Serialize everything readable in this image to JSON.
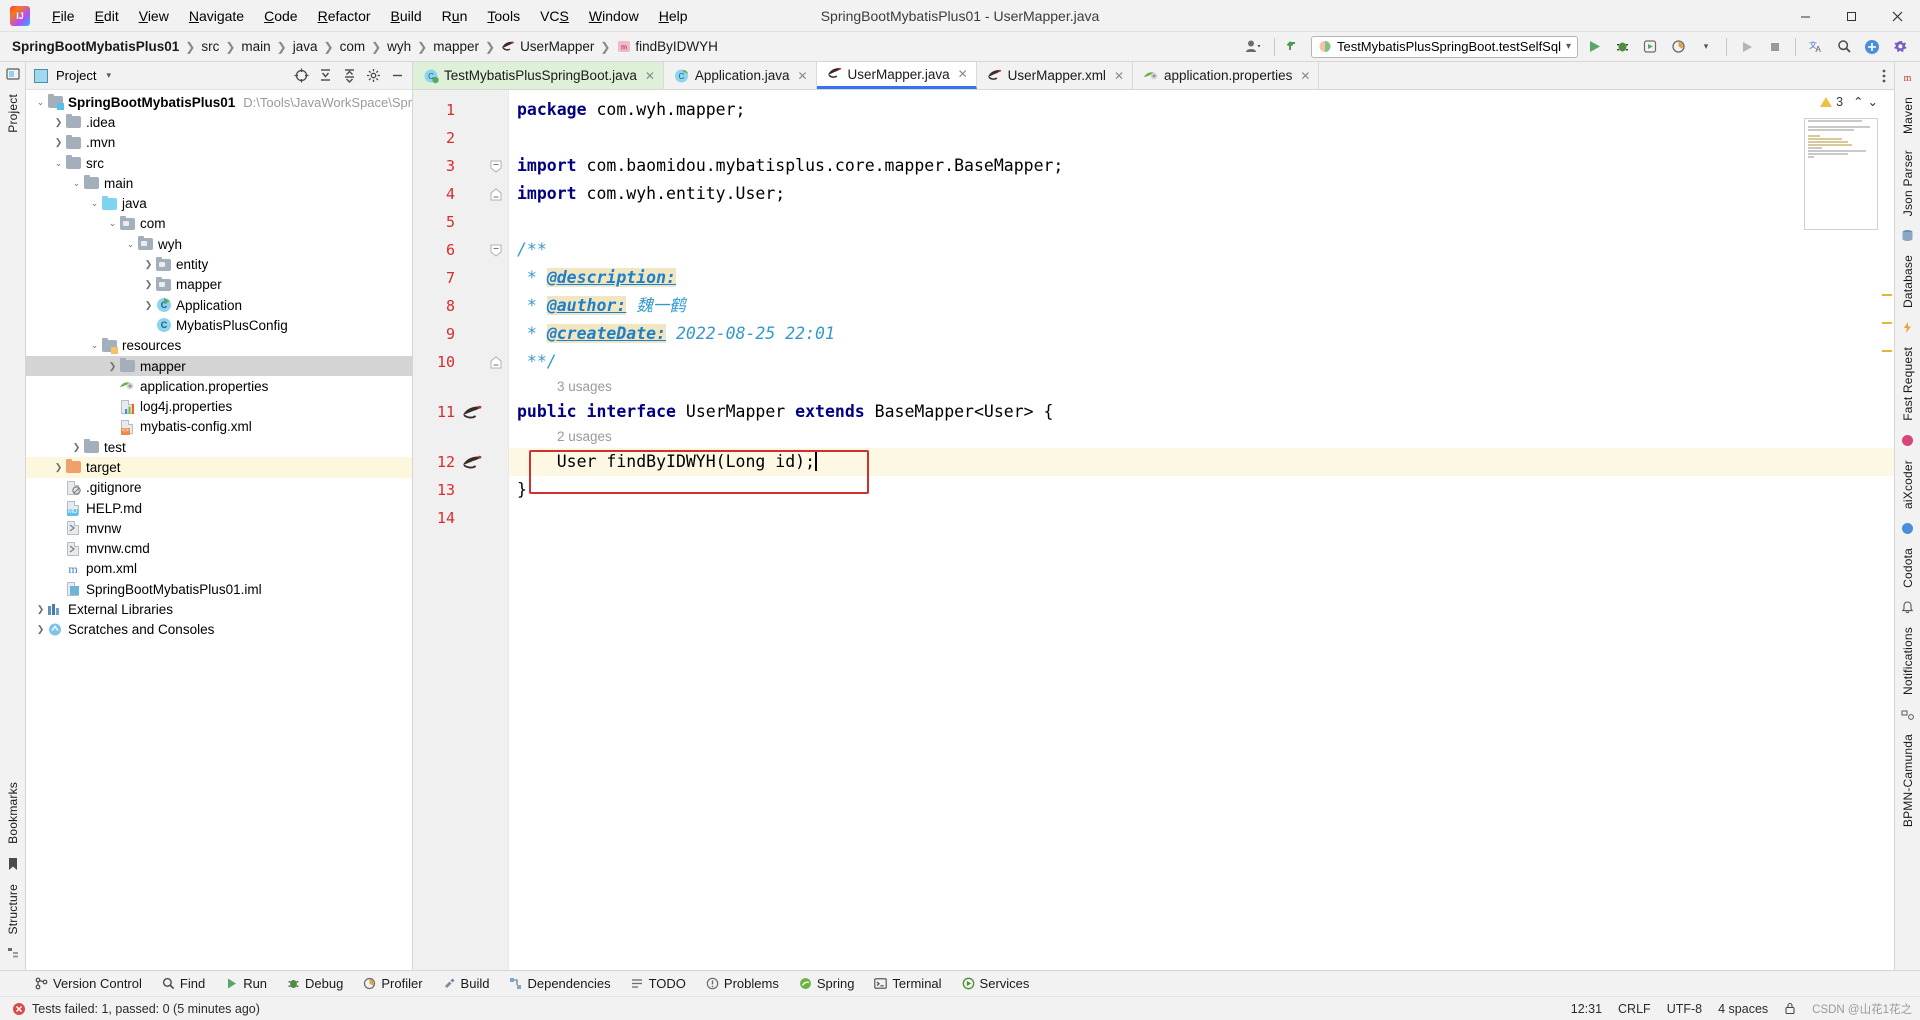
{
  "window": {
    "title": "SpringBootMybatisPlus01 - UserMapper.java",
    "minimize": "—",
    "maximize": "❐",
    "close": "✕"
  },
  "menu": [
    {
      "label": "File"
    },
    {
      "label": "Edit"
    },
    {
      "label": "View"
    },
    {
      "label": "Navigate"
    },
    {
      "label": "Code"
    },
    {
      "label": "Refactor"
    },
    {
      "label": "Build"
    },
    {
      "label": "Run"
    },
    {
      "label": "Tools"
    },
    {
      "label": "VCS"
    },
    {
      "label": "Window"
    },
    {
      "label": "Help"
    }
  ],
  "breadcrumb": [
    {
      "label": "SpringBootMybatisPlus01",
      "icon": "",
      "bold": true
    },
    {
      "label": "src",
      "icon": ""
    },
    {
      "label": "main",
      "icon": ""
    },
    {
      "label": "java",
      "icon": ""
    },
    {
      "label": "com",
      "icon": ""
    },
    {
      "label": "wyh",
      "icon": ""
    },
    {
      "label": "mapper",
      "icon": ""
    },
    {
      "label": "UserMapper",
      "icon": "interface-icon"
    },
    {
      "label": "findByIDWYH",
      "icon": "method-icon"
    }
  ],
  "toolbar": {
    "run_config": "TestMybatisPlusSpringBoot.testSelfSql",
    "run_config_chevron": "▾",
    "run_label": "Run",
    "debug_label": "Debug",
    "coverage_label": "Run with Coverage",
    "profile_label": "Profiler",
    "stop_label": "Stop",
    "translate_label": "Translate",
    "search_label": "Search Everywhere",
    "update_label": "Update Project",
    "settings_label": "Settings"
  },
  "left_rail": {
    "project": "Project",
    "bookmarks": "Bookmarks",
    "structure": "Structure"
  },
  "right_rail": {
    "items": [
      "Maven",
      "Json Parser",
      "Database",
      "Fast Request",
      "aiXcoder",
      "Codota",
      "Notifications",
      "BPMN-Camunda"
    ]
  },
  "project_panel": {
    "title": "Project",
    "chevron": "▾",
    "actions": [
      "locate-icon",
      "expand-all-icon",
      "collapse-all-icon",
      "settings-icon",
      "hide-icon"
    ],
    "tree": [
      {
        "depth": 0,
        "arrow": "v",
        "label": "SpringBootMybatisPlus01",
        "bold": true,
        "icon": "module-folder",
        "sub": "D:\\Tools\\JavaWorkSpace\\Sprin"
      },
      {
        "depth": 1,
        "arrow": ">",
        "label": ".idea",
        "icon": "folder"
      },
      {
        "depth": 1,
        "arrow": ">",
        "label": ".mvn",
        "icon": "folder"
      },
      {
        "depth": 1,
        "arrow": "v",
        "label": "src",
        "icon": "folder"
      },
      {
        "depth": 2,
        "arrow": "v",
        "label": "main",
        "icon": "folder"
      },
      {
        "depth": 3,
        "arrow": "v",
        "label": "java",
        "icon": "source-folder"
      },
      {
        "depth": 4,
        "arrow": "v",
        "label": "com",
        "icon": "package"
      },
      {
        "depth": 5,
        "arrow": "v",
        "label": "wyh",
        "icon": "package"
      },
      {
        "depth": 6,
        "arrow": ">",
        "label": "entity",
        "icon": "package"
      },
      {
        "depth": 6,
        "arrow": ">",
        "label": "mapper",
        "icon": "package"
      },
      {
        "depth": 6,
        "arrow": ">",
        "label": "Application",
        "icon": "class-runnable"
      },
      {
        "depth": 6,
        "arrow": "",
        "label": "MybatisPlusConfig",
        "icon": "class"
      },
      {
        "depth": 3,
        "arrow": "v",
        "label": "resources",
        "icon": "resources-folder"
      },
      {
        "depth": 4,
        "arrow": ">",
        "label": "mapper",
        "icon": "folder",
        "state": "selected"
      },
      {
        "depth": 4,
        "arrow": "",
        "label": "application.properties",
        "icon": "spring-properties"
      },
      {
        "depth": 4,
        "arrow": "",
        "label": "log4j.properties",
        "icon": "properties"
      },
      {
        "depth": 4,
        "arrow": "",
        "label": "mybatis-config.xml",
        "icon": "xml"
      },
      {
        "depth": 2,
        "arrow": ">",
        "label": "test",
        "icon": "folder"
      },
      {
        "depth": 1,
        "arrow": ">",
        "label": "target",
        "icon": "folder-orange",
        "state": "highlighted"
      },
      {
        "depth": 1,
        "arrow": "",
        "label": ".gitignore",
        "icon": "gitignore"
      },
      {
        "depth": 1,
        "arrow": "",
        "label": "HELP.md",
        "icon": "markdown"
      },
      {
        "depth": 1,
        "arrow": "",
        "label": "mvnw",
        "icon": "script"
      },
      {
        "depth": 1,
        "arrow": "",
        "label": "mvnw.cmd",
        "icon": "script-cmd"
      },
      {
        "depth": 1,
        "arrow": "",
        "label": "pom.xml",
        "icon": "maven"
      },
      {
        "depth": 1,
        "arrow": "",
        "label": "SpringBootMybatisPlus01.iml",
        "icon": "iml"
      },
      {
        "depth": 0,
        "arrow": ">",
        "label": "External Libraries",
        "icon": "libraries"
      },
      {
        "depth": 0,
        "arrow": ">",
        "label": "Scratches and Consoles",
        "icon": "scratches"
      }
    ]
  },
  "tabs": [
    {
      "label": "TestMybatisPlusSpringBoot.java",
      "icon": "test-class-icon",
      "state": "test-green",
      "close": "✕"
    },
    {
      "label": "Application.java",
      "icon": "spring-class-icon",
      "state": "normal",
      "close": "✕"
    },
    {
      "label": "UserMapper.java",
      "icon": "mybatis-icon",
      "state": "active",
      "close": "✕"
    },
    {
      "label": "UserMapper.xml",
      "icon": "mybatis-icon",
      "state": "normal",
      "close": "✕"
    },
    {
      "label": "application.properties",
      "icon": "spring-properties-icon",
      "state": "normal",
      "close": "✕"
    }
  ],
  "editor": {
    "inspection_count": "3",
    "inspection_up": "⌃",
    "inspection_down": "⌄",
    "lines": [
      {
        "num": "1",
        "gutter": "",
        "fold": "",
        "tokens": [
          {
            "t": "package",
            "c": "kw"
          },
          {
            "t": " com.wyh.mapper;",
            "c": "plain"
          }
        ]
      },
      {
        "num": "2",
        "gutter": "",
        "fold": "",
        "tokens": []
      },
      {
        "num": "3",
        "gutter": "",
        "fold": "down",
        "tokens": [
          {
            "t": "import",
            "c": "kw"
          },
          {
            "t": " com.baomidou.mybatisplus.core.mapper.BaseMapper;",
            "c": "plain"
          }
        ]
      },
      {
        "num": "4",
        "gutter": "",
        "fold": "up",
        "tokens": [
          {
            "t": "import",
            "c": "kw"
          },
          {
            "t": " com.wyh.entity.User;",
            "c": "plain"
          }
        ]
      },
      {
        "num": "5",
        "gutter": "",
        "fold": "",
        "tokens": []
      },
      {
        "num": "6",
        "gutter": "",
        "fold": "down",
        "tokens": [
          {
            "t": "/**",
            "c": "cmt"
          }
        ]
      },
      {
        "num": "7",
        "gutter": "",
        "fold": "",
        "tokens": [
          {
            "t": " * ",
            "c": "cmt"
          },
          {
            "t": "@description:",
            "c": "cmt-tag"
          }
        ]
      },
      {
        "num": "8",
        "gutter": "",
        "fold": "",
        "tokens": [
          {
            "t": " * ",
            "c": "cmt"
          },
          {
            "t": "@author:",
            "c": "cmt-tag"
          },
          {
            "t": " 魏一鹤",
            "c": "cmt-val"
          }
        ]
      },
      {
        "num": "9",
        "gutter": "",
        "fold": "",
        "tokens": [
          {
            "t": " * ",
            "c": "cmt"
          },
          {
            "t": "@createDate:",
            "c": "cmt-tag"
          },
          {
            "t": " 2022-08-25 22:01",
            "c": "cmt-val"
          }
        ]
      },
      {
        "num": "10",
        "gutter": "",
        "fold": "up",
        "tokens": [
          {
            "t": " **/",
            "c": "cmt"
          }
        ]
      },
      {
        "num": "11",
        "gutter": "mybatis",
        "fold": "",
        "usages": "3 usages",
        "tokens": [
          {
            "t": "public interface",
            "c": "kw"
          },
          {
            "t": " UserMapper ",
            "c": "plain"
          },
          {
            "t": "extends",
            "c": "kw"
          },
          {
            "t": " BaseMapper<User> {",
            "c": "plain"
          }
        ]
      },
      {
        "num": "12",
        "gutter": "mybatis",
        "fold": "",
        "usages": "2 usages",
        "highlight": true,
        "boxed": true,
        "tokens": [
          {
            "t": "    User findByIDWYH(Long id);",
            "c": "plain"
          }
        ]
      },
      {
        "num": "13",
        "gutter": "",
        "fold": "",
        "tokens": [
          {
            "t": "}",
            "c": "plain"
          }
        ]
      },
      {
        "num": "14",
        "gutter": "",
        "fold": "",
        "tokens": []
      }
    ]
  },
  "bottom_strip": [
    {
      "label": "Version Control",
      "icon": "branch-icon"
    },
    {
      "label": "Find",
      "icon": "search-icon"
    },
    {
      "label": "Run",
      "icon": "run-icon"
    },
    {
      "label": "Debug",
      "icon": "debug-icon"
    },
    {
      "label": "Profiler",
      "icon": "profiler-icon"
    },
    {
      "label": "Build",
      "icon": "build-icon"
    },
    {
      "label": "Dependencies",
      "icon": "dependencies-icon"
    },
    {
      "label": "TODO",
      "icon": "todo-icon"
    },
    {
      "label": "Problems",
      "icon": "problems-icon"
    },
    {
      "label": "Spring",
      "icon": "spring-icon"
    },
    {
      "label": "Terminal",
      "icon": "terminal-icon"
    },
    {
      "label": "Services",
      "icon": "services-icon"
    }
  ],
  "status_bar": {
    "message": "Tests failed: 1, passed: 0 (5 minutes ago)",
    "position": "12:31",
    "line_sep": "CRLF",
    "encoding": "UTF-8",
    "indent": "4 spaces",
    "lock": "lock-icon",
    "watermark": "CSDN @山花1花之"
  }
}
